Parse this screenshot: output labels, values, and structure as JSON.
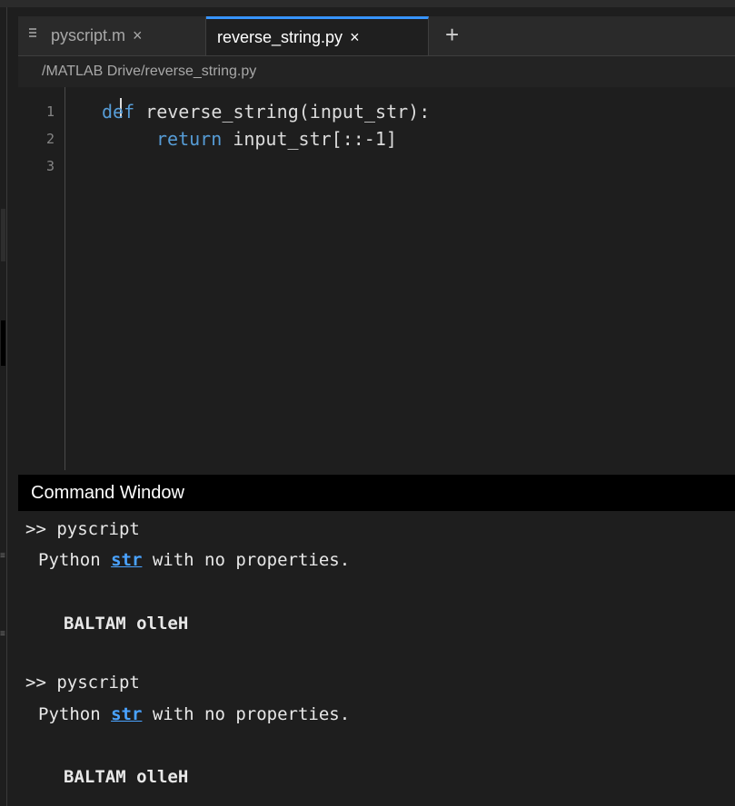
{
  "tabs": [
    {
      "label": "pyscript.m",
      "close": "×"
    },
    {
      "label": "reverse_string.py",
      "close": "×"
    }
  ],
  "add_tab_symbol": "+",
  "file_path": "/MATLAB Drive/reverse_string.py",
  "editor": {
    "line_numbers": [
      "1",
      "2",
      "3"
    ],
    "lines": [
      {
        "keyword": "def",
        "text": " reverse_string(input_str):"
      },
      {
        "keyword": "return",
        "text": " input_str[::-1]"
      },
      {
        "keyword": "",
        "text": ""
      }
    ]
  },
  "command_window": {
    "title": "Command Window",
    "entries": [
      {
        "prompt": ">> pyscript",
        "type_prefix": "Python ",
        "type_link": "str",
        "type_suffix": " with no properties.",
        "output": "BALTAM olleH"
      },
      {
        "prompt": ">> pyscript",
        "type_prefix": "Python ",
        "type_link": "str",
        "type_suffix": " with no properties.",
        "output": "BALTAM olleH"
      }
    ]
  }
}
